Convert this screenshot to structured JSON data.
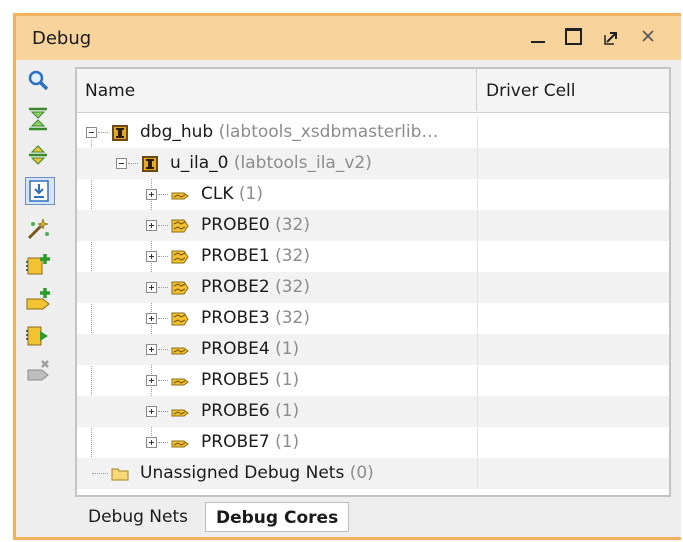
{
  "window": {
    "title": "Debug"
  },
  "toolbar": {
    "icons": [
      "search-icon",
      "collapse-all-icon",
      "expand-all-icon",
      "auto-connect-icon",
      "run-wizard-icon",
      "add-probes-icon",
      "create-debug-port-icon",
      "assign-net-icon",
      "delete-icon"
    ]
  },
  "table": {
    "columns": [
      "Name",
      "Driver Cell"
    ],
    "rows": [
      {
        "name": "dbg_hub",
        "meta": "(labtools_xsdbmasterlib…",
        "driver": ""
      },
      {
        "name": "u_ila_0",
        "meta": "(labtools_ila_v2)",
        "driver": ""
      },
      {
        "name": "CLK",
        "meta": "(1)",
        "driver": ""
      },
      {
        "name": "PROBE0",
        "meta": "(32)",
        "driver": ""
      },
      {
        "name": "PROBE1",
        "meta": "(32)",
        "driver": ""
      },
      {
        "name": "PROBE2",
        "meta": "(32)",
        "driver": ""
      },
      {
        "name": "PROBE3",
        "meta": "(32)",
        "driver": ""
      },
      {
        "name": "PROBE4",
        "meta": "(1)",
        "driver": ""
      },
      {
        "name": "PROBE5",
        "meta": "(1)",
        "driver": ""
      },
      {
        "name": "PROBE6",
        "meta": "(1)",
        "driver": ""
      },
      {
        "name": "PROBE7",
        "meta": "(1)",
        "driver": ""
      },
      {
        "name": "Unassigned Debug Nets",
        "meta": "(0)",
        "driver": ""
      }
    ]
  },
  "tabs": [
    {
      "label": "Debug Nets"
    },
    {
      "label": "Debug Cores"
    }
  ],
  "colors": {
    "title_bar": "#f8d39b",
    "frame_border": "#f4b15d",
    "core_icon": "#b8860b",
    "probe_icon": "#f1c232"
  }
}
